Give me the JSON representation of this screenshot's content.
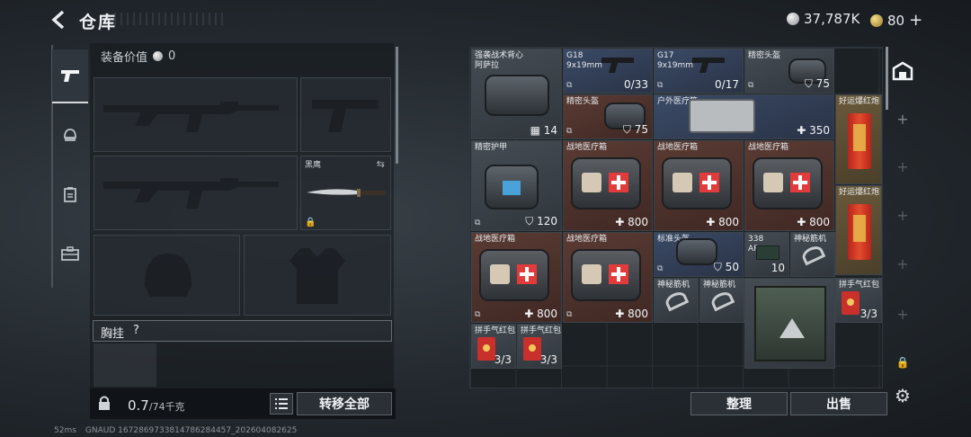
{
  "header": {
    "title": "仓库",
    "silver_amount": "37,787K",
    "gold_amount": "80",
    "gold_add": "+"
  },
  "nav": {
    "items": [
      {
        "name": "weapons",
        "icon": "pistol-icon"
      },
      {
        "name": "armor",
        "icon": "helmet-icon"
      },
      {
        "name": "items",
        "icon": "clipboard-icon"
      },
      {
        "name": "toolbox",
        "icon": "toolbox-icon"
      }
    ]
  },
  "equipment": {
    "value_label": "装备价值",
    "value": "0",
    "knife_name": "黑鹰",
    "vest_label": "胸挂",
    "vest_help": "?",
    "weight_current": "0.7",
    "weight_max": "/74千克",
    "transfer_all": "转移全部"
  },
  "inventory": {
    "items": [
      {
        "name": "强袭战术背心\n阿萨拉",
        "qty": "14",
        "qty_icon": "grid-icon"
      },
      {
        "name": "G18\n9x19mm",
        "qty": "0/33"
      },
      {
        "name": "G17\n9x19mm",
        "qty": "0/17"
      },
      {
        "name": "精密头盔",
        "qty": "75",
        "qty_icon": "shield-icon"
      },
      {
        "name": "精密头盔",
        "qty": "75",
        "qty_icon": "shield-icon"
      },
      {
        "name": "户外医疗箱",
        "qty": "350",
        "qty_icon": "plus-icon"
      },
      {
        "name": "好运爆红炮",
        "qty": ""
      },
      {
        "name": "精密护甲",
        "qty": "120",
        "qty_icon": "shield-icon"
      },
      {
        "name": "战地医疗箱",
        "qty": "800",
        "qty_icon": "plus-icon"
      },
      {
        "name": "战地医疗箱",
        "qty": "800",
        "qty_icon": "plus-icon"
      },
      {
        "name": "战地医疗箱",
        "qty": "800",
        "qty_icon": "plus-icon"
      },
      {
        "name": "好运爆红炮",
        "qty": ""
      },
      {
        "name": "战地医疗箱",
        "qty": "800",
        "qty_icon": "plus-icon"
      },
      {
        "name": "战地医疗箱",
        "qty": "800",
        "qty_icon": "plus-icon"
      },
      {
        "name": "标准头盔",
        "qty": "50",
        "qty_icon": "shield-icon"
      },
      {
        "name": "338\nAP",
        "qty": "10"
      },
      {
        "name": "神秘筋机",
        "qty": ""
      },
      {
        "name": "神秘筋机",
        "qty": ""
      },
      {
        "name": "神秘筋机",
        "qty": ""
      },
      {
        "name": "拼手气红包",
        "qty": "3/3"
      },
      {
        "name": "拼手气红包",
        "qty": "3/3"
      },
      {
        "name": "拼手气红包",
        "qty": "3/3"
      }
    ],
    "sort_button": "整理",
    "sell_button": "出售"
  },
  "status_bar": {
    "ping": "52ms",
    "build": "GNAUD 1672869733814786284457_202604082625"
  },
  "colors": {
    "accent_red": "#e23b3b",
    "panel_bg": "#1c2126",
    "gold": "#d6b04a"
  }
}
